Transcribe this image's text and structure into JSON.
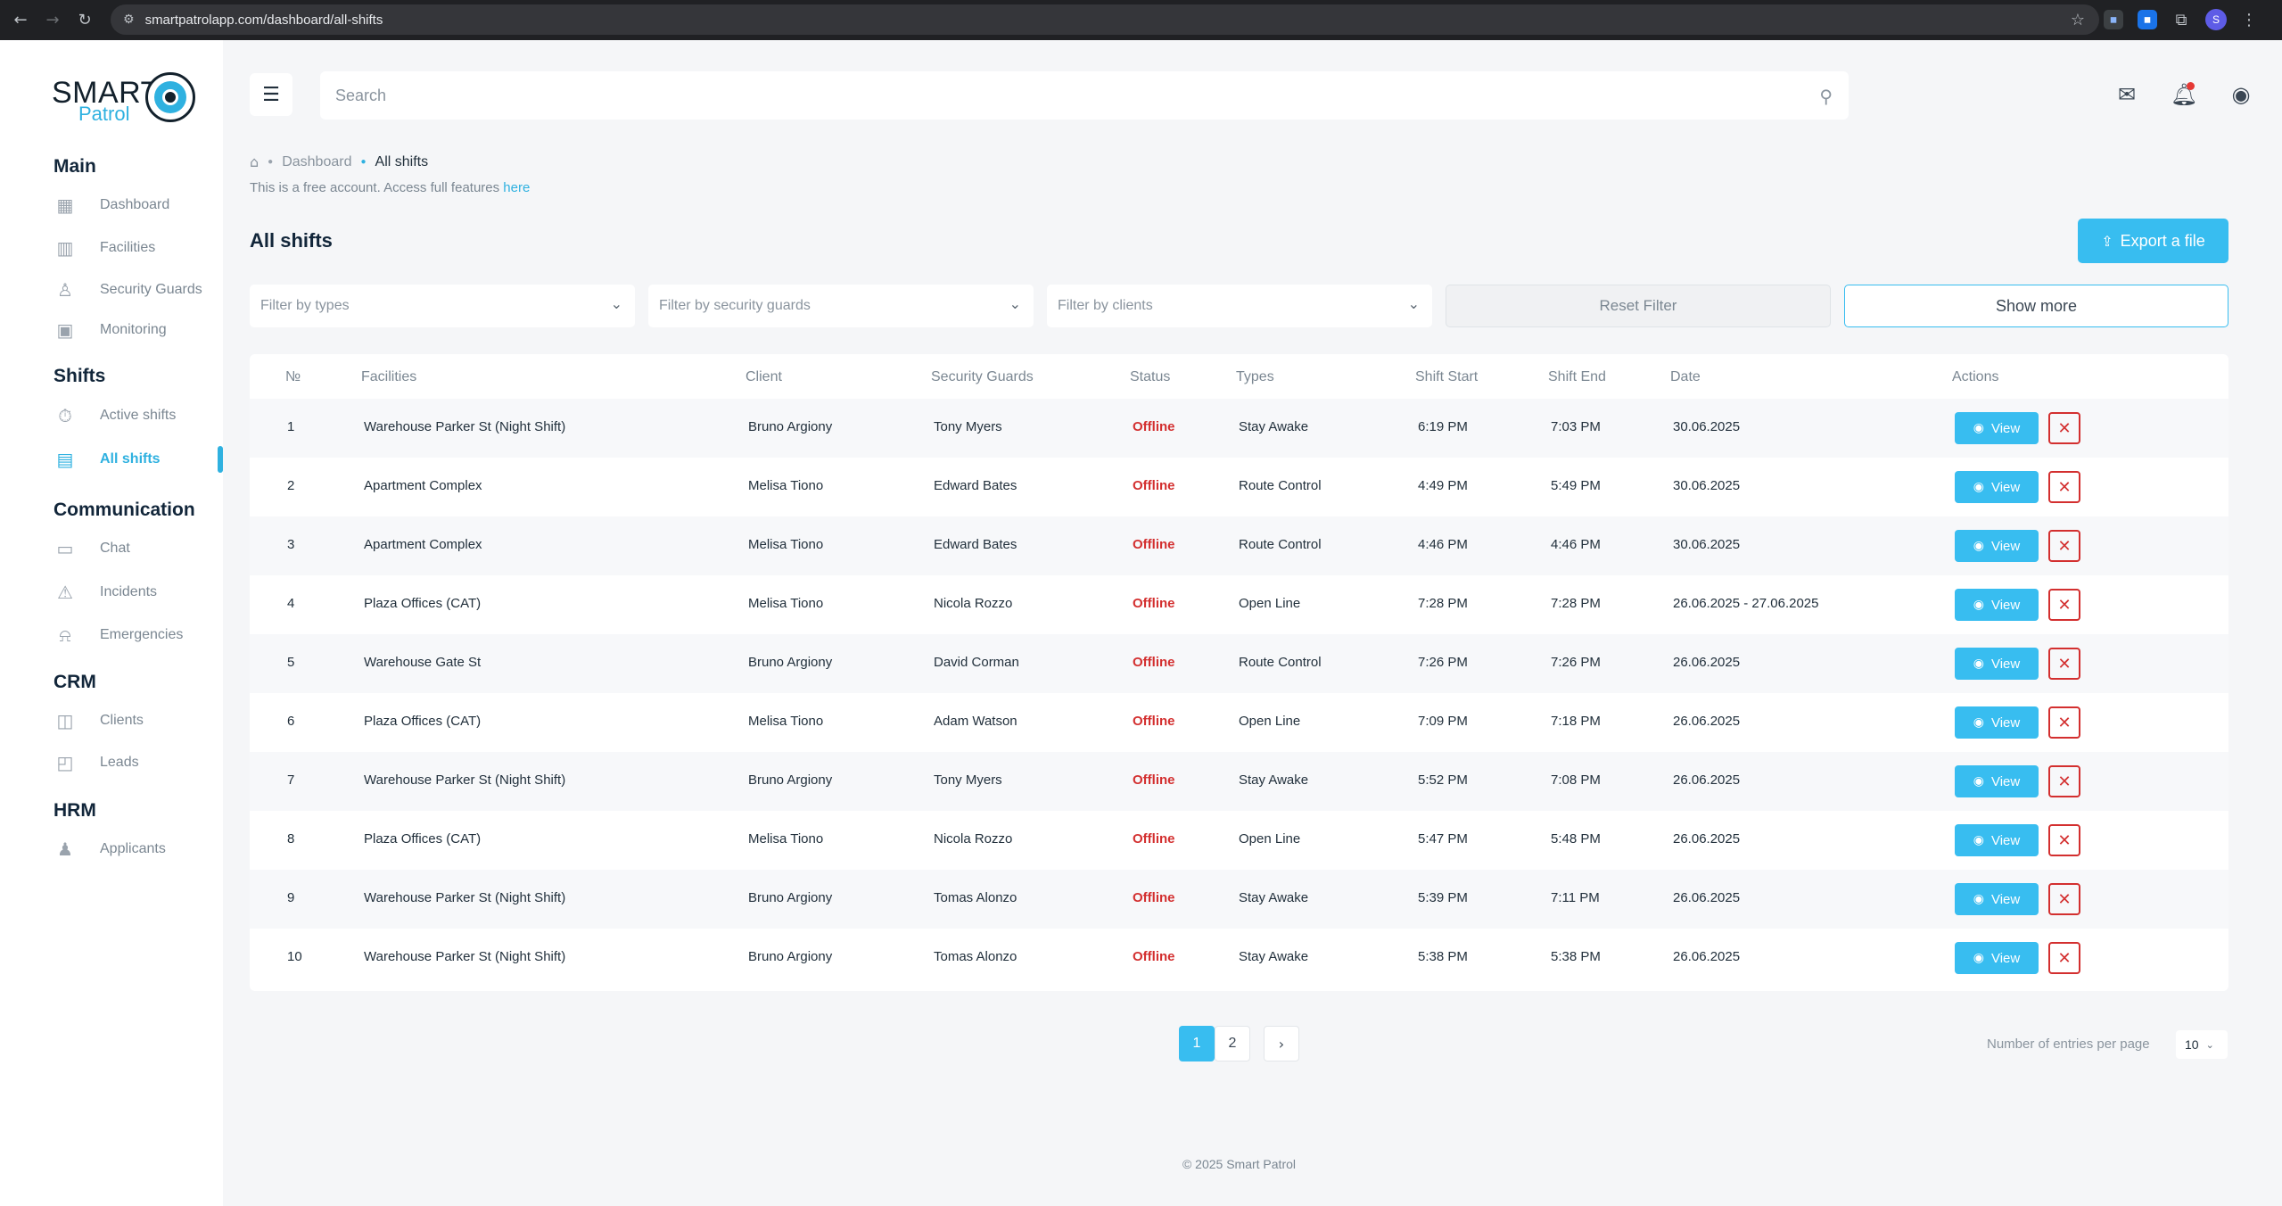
{
  "browser": {
    "url": "smartpatrolapp.com/dashboard/all-shifts",
    "profile_initial": "S"
  },
  "logo": {
    "line1": "SMART",
    "line2": "Patrol"
  },
  "sidebar": {
    "sections": [
      {
        "title": "Main",
        "items": [
          {
            "label": "Dashboard",
            "icon": "grid-icon"
          },
          {
            "label": "Facilities",
            "icon": "building-icon"
          },
          {
            "label": "Security Guards",
            "icon": "guard-icon"
          },
          {
            "label": "Monitoring",
            "icon": "monitor-icon"
          }
        ]
      },
      {
        "title": "Shifts",
        "items": [
          {
            "label": "Active shifts",
            "icon": "timer-icon"
          },
          {
            "label": "All shifts",
            "icon": "calendar-icon"
          }
        ]
      },
      {
        "title": "Communication",
        "items": [
          {
            "label": "Chat",
            "icon": "chat-icon"
          },
          {
            "label": "Incidents",
            "icon": "incident-icon"
          },
          {
            "label": "Emergencies",
            "icon": "alarm-icon"
          }
        ]
      },
      {
        "title": "CRM",
        "items": [
          {
            "label": "Clients",
            "icon": "clients-icon"
          },
          {
            "label": "Leads",
            "icon": "leads-icon"
          }
        ]
      },
      {
        "title": "HRM",
        "items": [
          {
            "label": "Applicants",
            "icon": "applicants-icon"
          }
        ]
      }
    ]
  },
  "search": {
    "placeholder": "Search"
  },
  "breadcrumb": {
    "level1": "Dashboard",
    "current": "All shifts"
  },
  "notice": {
    "text": "This is a free account. Access full features ",
    "link": "here"
  },
  "page": {
    "title": "All shifts",
    "export_label": "Export a file"
  },
  "filters": {
    "types_placeholder": "Filter by types",
    "guards_placeholder": "Filter by security guards",
    "clients_placeholder": "Filter by clients",
    "reset_label": "Reset Filter",
    "more_label": "Show more"
  },
  "table": {
    "headers": [
      "№",
      "Facilities",
      "Client",
      "Security Guards",
      "Status",
      "Types",
      "Shift Start",
      "Shift End",
      "Date",
      "Actions"
    ],
    "view_label": "View",
    "rows": [
      {
        "n": "1",
        "facility": "Warehouse Parker St (Night Shift)",
        "client": "Bruno Argiony",
        "guard": "Tony Myers",
        "status": "Offline",
        "type": "Stay Awake",
        "start": "6:19 PM",
        "end": "7:03 PM",
        "date": "30.06.2025"
      },
      {
        "n": "2",
        "facility": "Apartment Complex",
        "client": "Melisa Tiono",
        "guard": "Edward Bates",
        "status": "Offline",
        "type": "Route Control",
        "start": "4:49 PM",
        "end": "5:49 PM",
        "date": "30.06.2025"
      },
      {
        "n": "3",
        "facility": "Apartment Complex",
        "client": "Melisa Tiono",
        "guard": "Edward Bates",
        "status": "Offline",
        "type": "Route Control",
        "start": "4:46 PM",
        "end": "4:46 PM",
        "date": "30.06.2025"
      },
      {
        "n": "4",
        "facility": "Plaza Offices (CAT)",
        "client": "Melisa Tiono",
        "guard": "Nicola Rozzo",
        "status": "Offline",
        "type": "Open Line",
        "start": "7:28 PM",
        "end": "7:28 PM",
        "date": "26.06.2025 - 27.06.2025"
      },
      {
        "n": "5",
        "facility": "Warehouse Gate St",
        "client": "Bruno Argiony",
        "guard": "David Corman",
        "status": "Offline",
        "type": "Route Control",
        "start": "7:26 PM",
        "end": "7:26 PM",
        "date": "26.06.2025"
      },
      {
        "n": "6",
        "facility": "Plaza Offices (CAT)",
        "client": "Melisa Tiono",
        "guard": "Adam Watson",
        "status": "Offline",
        "type": "Open Line",
        "start": "7:09 PM",
        "end": "7:18 PM",
        "date": "26.06.2025"
      },
      {
        "n": "7",
        "facility": "Warehouse Parker St (Night Shift)",
        "client": "Bruno Argiony",
        "guard": "Tony Myers",
        "status": "Offline",
        "type": "Stay Awake",
        "start": "5:52 PM",
        "end": "7:08 PM",
        "date": "26.06.2025"
      },
      {
        "n": "8",
        "facility": "Plaza Offices (CAT)",
        "client": "Melisa Tiono",
        "guard": "Nicola Rozzo",
        "status": "Offline",
        "type": "Open Line",
        "start": "5:47 PM",
        "end": "5:48 PM",
        "date": "26.06.2025"
      },
      {
        "n": "9",
        "facility": "Warehouse Parker St (Night Shift)",
        "client": "Bruno Argiony",
        "guard": "Tomas Alonzo",
        "status": "Offline",
        "type": "Stay Awake",
        "start": "5:39 PM",
        "end": "7:11 PM",
        "date": "26.06.2025"
      },
      {
        "n": "10",
        "facility": "Warehouse Parker St (Night Shift)",
        "client": "Bruno Argiony",
        "guard": "Tomas Alonzo",
        "status": "Offline",
        "type": "Stay Awake",
        "start": "5:38 PM",
        "end": "5:38 PM",
        "date": "26.06.2025"
      }
    ]
  },
  "pagination": {
    "pages": [
      "1",
      "2"
    ],
    "current": "1",
    "entries_label": "Number of entries per page",
    "entries_value": "10"
  },
  "footer": {
    "text": "© 2025 Smart Patrol"
  },
  "colors": {
    "accent": "#38bdf0",
    "danger": "#d32f2f",
    "heading": "#12263a"
  }
}
